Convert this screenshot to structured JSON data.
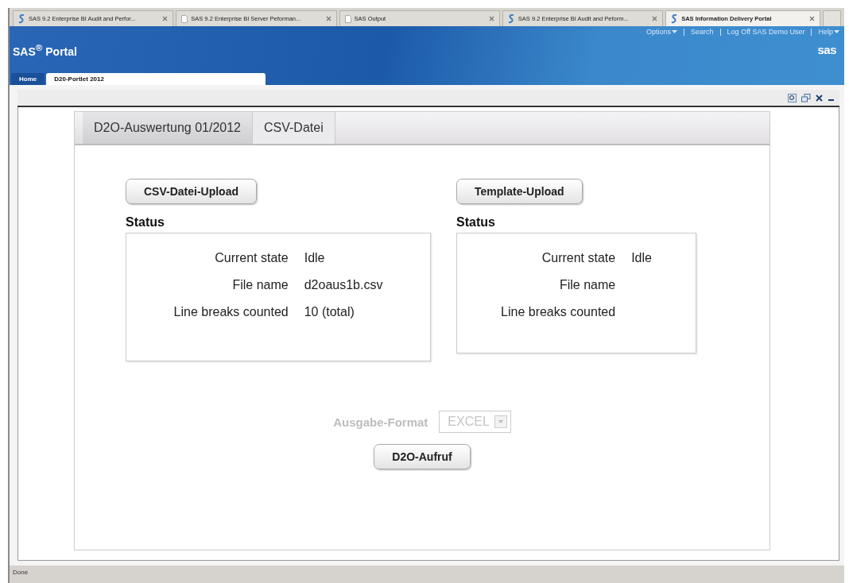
{
  "browser_tabs": [
    {
      "title": "SAS 9.2 Enterprise BI Audit and Perfor...",
      "kind": "sas",
      "selected": false
    },
    {
      "title": "SAS 9.2 Enterprise BI Server Peforman...",
      "kind": "page",
      "selected": false
    },
    {
      "title": "SAS Output",
      "kind": "page",
      "selected": false
    },
    {
      "title": "SAS 9.2 Enterprise BI Audit and Peform...",
      "kind": "sas",
      "selected": false
    },
    {
      "title": "SAS Information Delivery Portal",
      "kind": "sas",
      "selected": true
    }
  ],
  "header": {
    "links": [
      {
        "label": "Options",
        "dropdown": true
      },
      {
        "label": "Search",
        "dropdown": false
      },
      {
        "label": "Log Off SAS Demo User",
        "dropdown": false
      },
      {
        "label": "Help",
        "dropdown": true
      }
    ],
    "title": "SAS$^{®}$ Portal",
    "logo": "sas"
  },
  "portal_tabs": [
    {
      "label": "Home",
      "selected": false
    },
    {
      "label": "D20-Portlet 2012",
      "selected": true
    }
  ],
  "portlet": {
    "tabs": [
      {
        "label": "D2O-Auswertung 01/2012",
        "selected": true
      },
      {
        "label": "CSV-Datei",
        "selected": false
      }
    ],
    "panels": [
      {
        "button": "CSV-Datei-Upload",
        "status_label": "Status",
        "rows": [
          {
            "label": "Current state",
            "value": "Idle"
          },
          {
            "label": "File name",
            "value": "d2oaus1b.csv"
          },
          {
            "label": "Line breaks counted",
            "value": "10 (total)"
          }
        ]
      },
      {
        "button": "Template-Upload",
        "status_label": "Status",
        "rows": [
          {
            "label": "Current state",
            "value": "Idle"
          },
          {
            "label": "File name"
          },
          {
            "label": "Line breaks counted"
          }
        ]
      }
    ],
    "format": {
      "label": "Ausgabe-Format",
      "value": "EXCEL",
      "disabled": true
    },
    "run_button": "D2O-Aufruf"
  },
  "status_bar": "Done"
}
